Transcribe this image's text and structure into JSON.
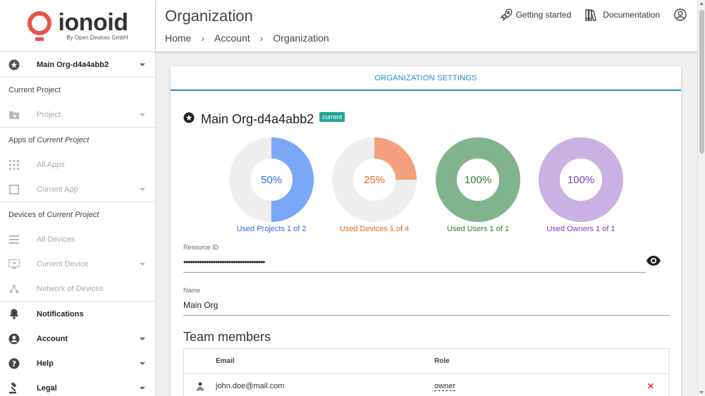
{
  "brand": {
    "name": "ionoid",
    "tagline": "By Open Devices GmbH",
    "color": "#e8524a"
  },
  "sidebar": {
    "org_selector": {
      "label": "Main Org-d4a4abb2",
      "icon": "star-circle-icon"
    },
    "current_project_heading": "Current Project",
    "project": {
      "label": "Project",
      "icon": "folder-star-icon"
    },
    "apps_heading_prefix": "Apps of ",
    "apps_heading_em": "Current Project",
    "all_apps": {
      "label": "All Apps",
      "icon": "grid-icon"
    },
    "current_app": {
      "label": "Current App",
      "icon": "square-icon"
    },
    "devices_heading_prefix": "Devices of ",
    "devices_heading_em": "Current Project",
    "all_devices": {
      "label": "All Devices",
      "icon": "list-icon"
    },
    "current_device": {
      "label": "Current Device",
      "icon": "device-icon"
    },
    "network_devices": {
      "label": "Network of Devices",
      "icon": "network-icon"
    },
    "notifications": {
      "label": "Notifications",
      "icon": "bell-icon"
    },
    "account": {
      "label": "Account",
      "icon": "account-circle-icon"
    },
    "help": {
      "label": "Help",
      "icon": "help-circle-icon"
    },
    "legal": {
      "label": "Legal",
      "icon": "gavel-icon"
    }
  },
  "header": {
    "title": "Organization",
    "breadcrumb": [
      "Home",
      "Account",
      "Organization"
    ],
    "getting_started": "Getting started",
    "documentation": "Documentation"
  },
  "card": {
    "tab": "ORGANIZATION SETTINGS",
    "org_name": "Main Org-d4a4abb2",
    "badge": "current",
    "usage": [
      {
        "percent": "50%",
        "fraction": 0.5,
        "caption": "Used Projects 1 of 2",
        "color": "#7ba7f7",
        "text_color": "#2b6fd6"
      },
      {
        "percent": "25%",
        "fraction": 0.25,
        "caption": "Used Devices 1 of 4",
        "color": "#f4a07e",
        "text_color": "#e06a1f"
      },
      {
        "percent": "100%",
        "fraction": 1.0,
        "caption": "Used Users 1 of 1",
        "color": "#82b38f",
        "text_color": "#2e7d32"
      },
      {
        "percent": "100%",
        "fraction": 1.0,
        "caption": "Used Owners 1 of 1",
        "color": "#c9b1e4",
        "text_color": "#7b3fb8"
      }
    ],
    "resource_id": {
      "label": "Resource ID",
      "value": "••••••••••••••••••••••••••••••••••••"
    },
    "name": {
      "label": "Name",
      "value": "Main Org"
    },
    "team_title": "Team members",
    "table": {
      "headers": [
        "Email",
        "Role"
      ],
      "rows": [
        {
          "email": "john.doe@mail.com",
          "role": "owner"
        }
      ]
    }
  }
}
